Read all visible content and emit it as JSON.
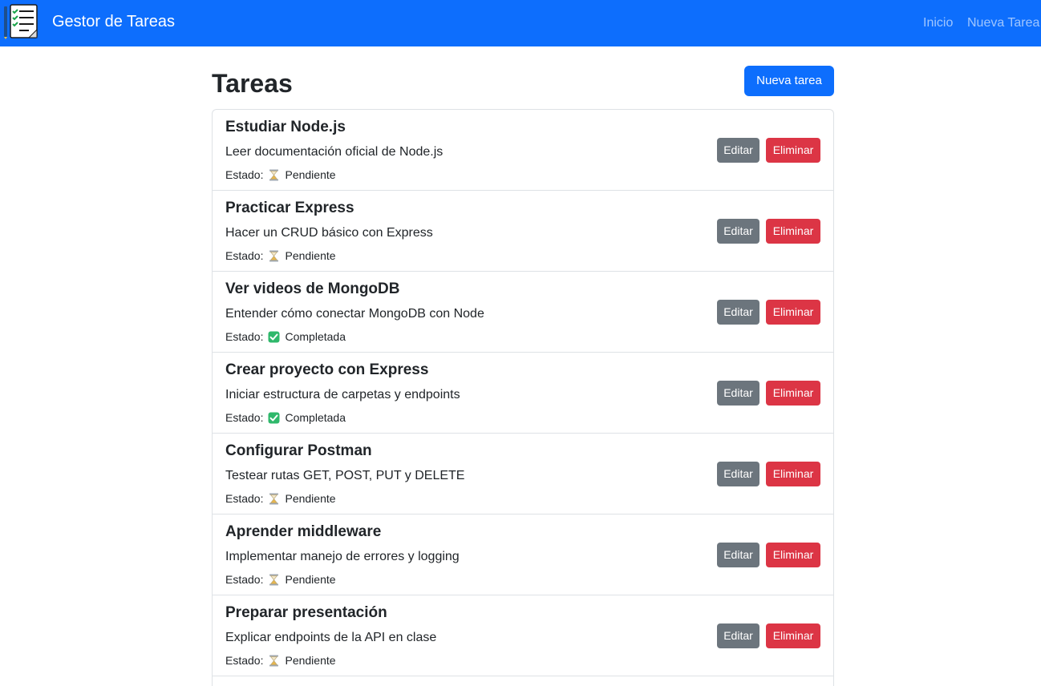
{
  "navbar": {
    "brand_title": "Gestor de Tareas",
    "logo_icon": "checklist-notepad-icon",
    "links": [
      "Inicio",
      "Nueva Tarea"
    ],
    "background": "#0d6efd"
  },
  "main": {
    "title": "Tareas",
    "new_task_button": "Nueva tarea",
    "status_prefix": "Estado:",
    "edit_label": "Editar",
    "delete_label": "Eliminar"
  },
  "tasks": [
    {
      "title": "Estudiar Node.js",
      "description": "Leer documentación oficial de Node.js",
      "status_icon": "hourglass-icon",
      "status": "Pendiente"
    },
    {
      "title": "Practicar Express",
      "description": "Hacer un CRUD básico con Express",
      "status_icon": "hourglass-icon",
      "status": "Pendiente"
    },
    {
      "title": "Ver videos de MongoDB",
      "description": "Entender cómo conectar MongoDB con Node",
      "status_icon": "check-mark-icon",
      "status": "Completada"
    },
    {
      "title": "Crear proyecto con Express",
      "description": "Iniciar estructura de carpetas y endpoints",
      "status_icon": "check-mark-icon",
      "status": "Completada"
    },
    {
      "title": "Configurar Postman",
      "description": "Testear rutas GET, POST, PUT y DELETE",
      "status_icon": "hourglass-icon",
      "status": "Pendiente"
    },
    {
      "title": "Aprender middleware",
      "description": "Implementar manejo de errores y logging",
      "status_icon": "hourglass-icon",
      "status": "Pendiente"
    },
    {
      "title": "Preparar presentación",
      "description": "Explicar endpoints de la API en clase",
      "status_icon": "hourglass-icon",
      "status": "Pendiente"
    }
  ],
  "colors": {
    "primary": "#0d6efd",
    "secondary": "#6c757d",
    "danger": "#dc3545",
    "success": "#2fb86b",
    "border": "#dee2e6"
  }
}
